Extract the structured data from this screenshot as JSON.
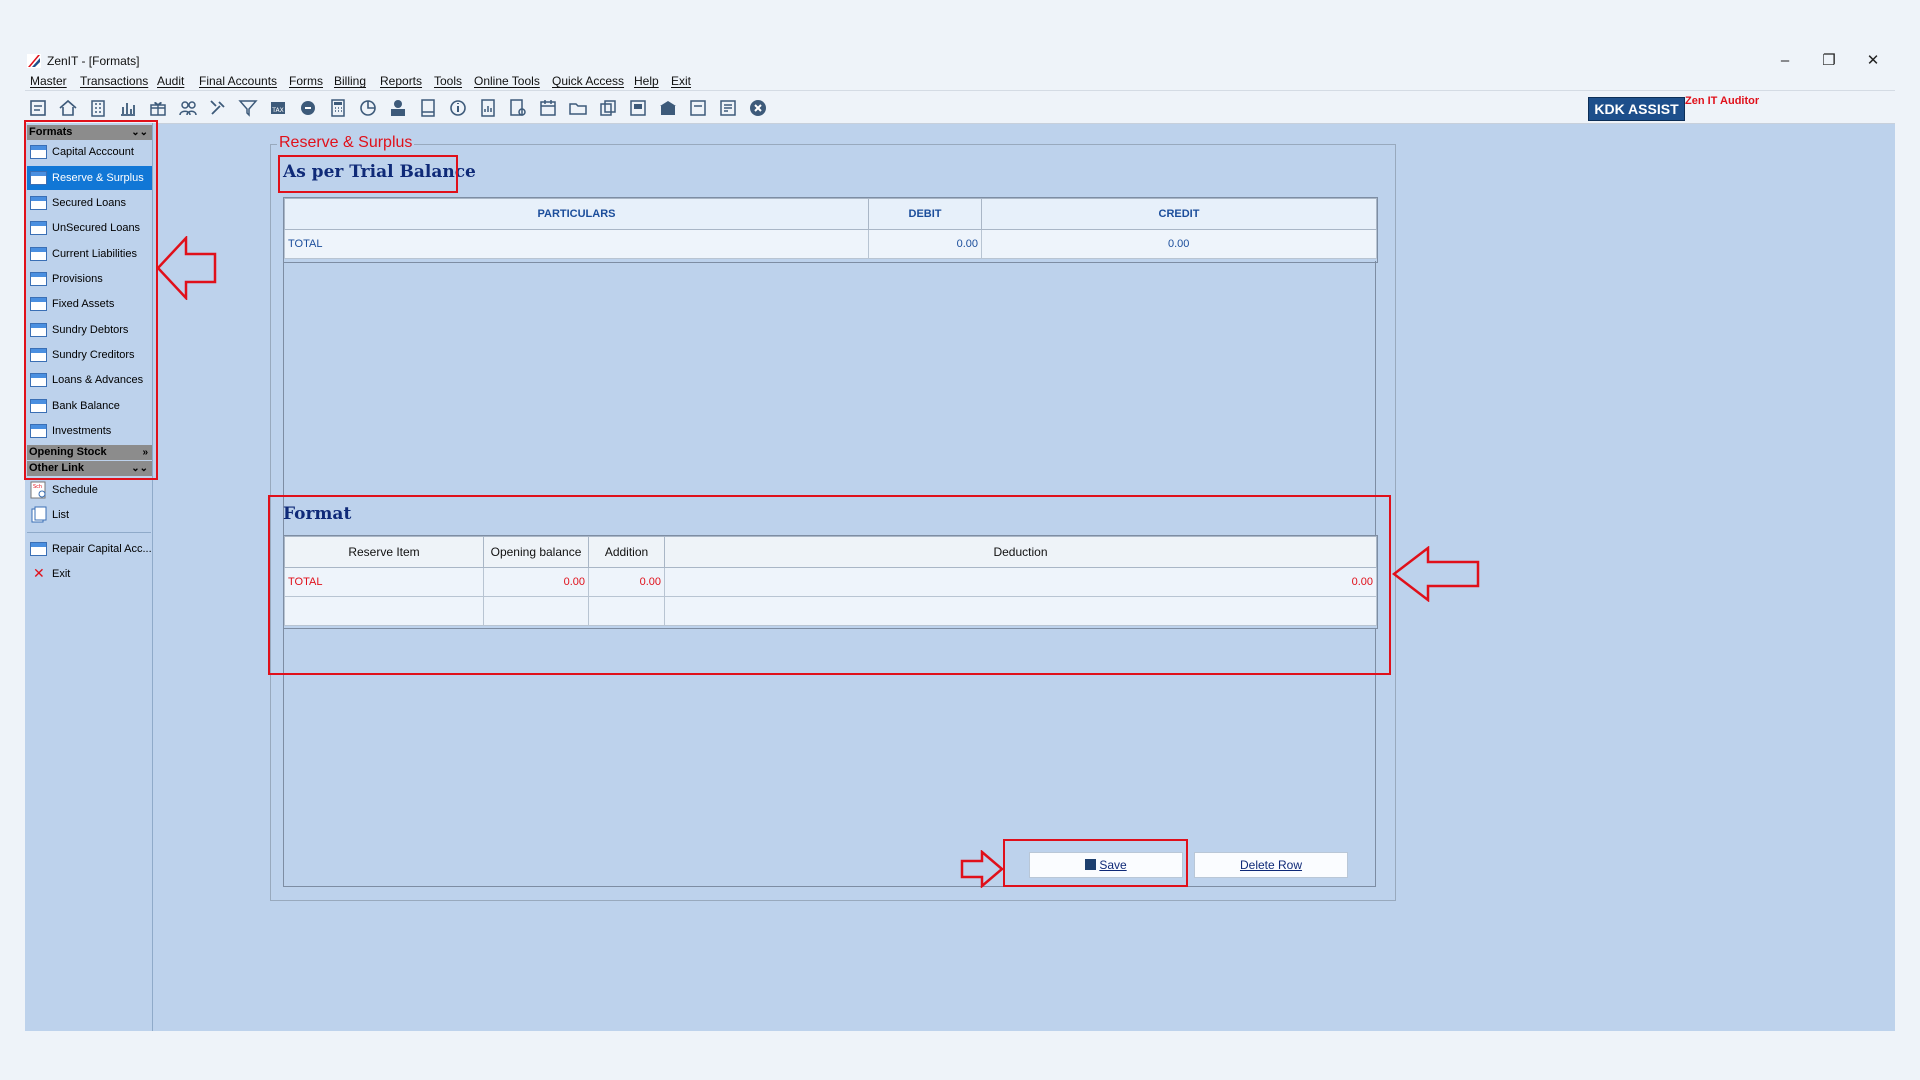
{
  "window": {
    "title": "ZenIT - [Formats]"
  },
  "menu": [
    "Master",
    "Transactions",
    "Audit",
    "Final Accounts",
    "Forms",
    "Billing",
    "Reports",
    "Tools",
    "Online Tools",
    "Quick Access",
    "Help",
    "Exit"
  ],
  "toolbar": {
    "kdk_label": "KDK ASSIST",
    "auditor_label": "Zen IT Auditor"
  },
  "sidebar": {
    "formats_group": "Formats",
    "items": [
      "Capital Acccount",
      "Reserve & Surplus",
      "Secured Loans",
      "UnSecured Loans",
      "Current Liabilities",
      "Provisions",
      "Fixed Assets",
      "Sundry Debtors",
      "Sundry Creditors",
      "Loans & Advances",
      "Bank Balance",
      "Investments"
    ],
    "selected_index": 1,
    "opening_stock_group": "Opening Stock",
    "other_link_group": "Other Link",
    "schedule": "Schedule",
    "list": "List",
    "repair": "Repair Capital Acc...",
    "exit": "Exit"
  },
  "panel": {
    "legend": "Reserve & Surplus",
    "trial_heading": "As per Trial Balance",
    "trial_columns": [
      "PARTICULARS",
      "DEBIT",
      "CREDIT"
    ],
    "trial_total": {
      "label": "TOTAL",
      "debit": "0.00",
      "credit": "0.00"
    },
    "format_heading": "Format",
    "format_columns": [
      "Reserve Item",
      "Opening balance",
      "Addition",
      "Deduction"
    ],
    "format_total": {
      "label": "TOTAL",
      "opening": "0.00",
      "addition": "0.00",
      "deduction": "0.00"
    },
    "save_label": "Save",
    "delete_label": "Delete Row"
  },
  "colors": {
    "annotation": "#e0101a",
    "selected": "#1177d6",
    "background": "#bdd2ec"
  }
}
